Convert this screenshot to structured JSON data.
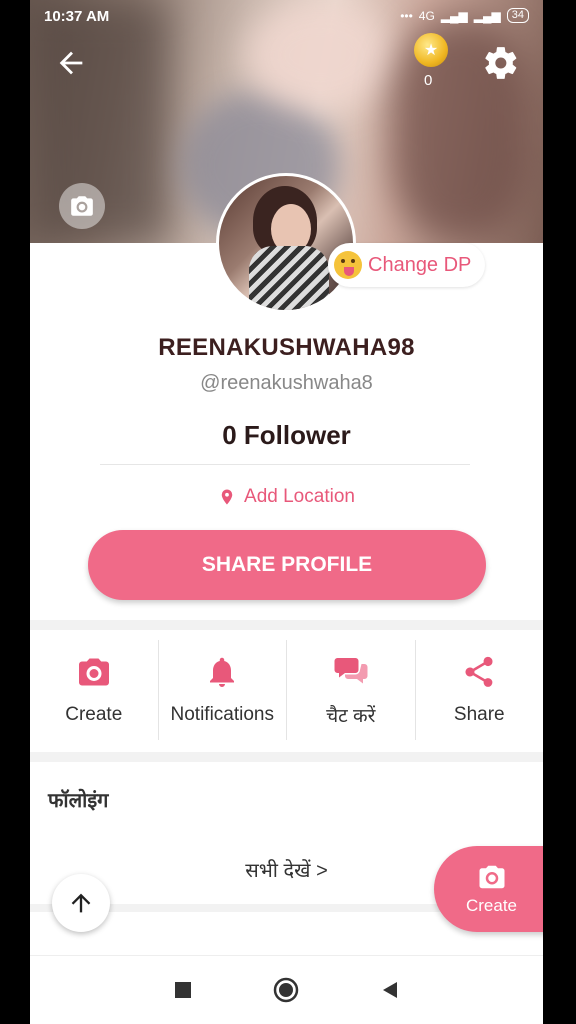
{
  "status_bar": {
    "time": "10:37 AM",
    "network": "4G",
    "battery": "34"
  },
  "header": {
    "coin_count": "0"
  },
  "profile": {
    "change_dp_label": "Change DP",
    "username": "REENAKUSHWAHA98",
    "handle": "@reenakushwaha8",
    "followers": "0 Follower",
    "add_location": "Add Location",
    "share_button": "SHARE PROFILE"
  },
  "actions": [
    {
      "label": "Create",
      "icon": "camera-icon"
    },
    {
      "label": "Notifications",
      "icon": "bell-icon"
    },
    {
      "label": "चैट करें",
      "icon": "chat-icon"
    },
    {
      "label": "Share",
      "icon": "share-icon"
    }
  ],
  "following": {
    "title": "फॉलोइंग",
    "see_all": "सभी देखें >"
  },
  "fab": {
    "label": "Create"
  },
  "colors": {
    "accent": "#f06a88",
    "text_accent": "#e8587a"
  }
}
